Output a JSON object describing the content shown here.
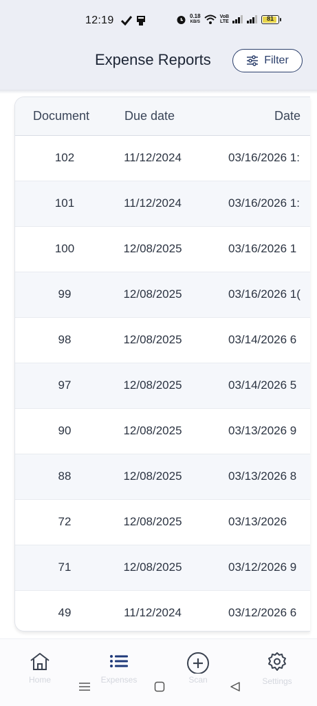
{
  "status_bar": {
    "time": "12:19",
    "speed_value": "0.18",
    "speed_unit": "KB/S",
    "volte_top": "VoB",
    "volte_bottom": "LTE",
    "battery": "81"
  },
  "header": {
    "title": "Expense Reports",
    "filter_label": "Filter"
  },
  "table": {
    "columns": [
      "Document",
      "Due date",
      "Date"
    ],
    "rows": [
      {
        "document": "102",
        "due_date": "11/12/2024",
        "date": "03/16/2026 1:"
      },
      {
        "document": "101",
        "due_date": "11/12/2024",
        "date": "03/16/2026 1:"
      },
      {
        "document": "100",
        "due_date": "12/08/2025",
        "date": "03/16/2026 1"
      },
      {
        "document": "99",
        "due_date": "12/08/2025",
        "date": "03/16/2026 1("
      },
      {
        "document": "98",
        "due_date": "12/08/2025",
        "date": "03/14/2026 6"
      },
      {
        "document": "97",
        "due_date": "12/08/2025",
        "date": "03/14/2026 5"
      },
      {
        "document": "90",
        "due_date": "12/08/2025",
        "date": "03/13/2026 9"
      },
      {
        "document": "88",
        "due_date": "12/08/2025",
        "date": "03/13/2026 8"
      },
      {
        "document": "72",
        "due_date": "12/08/2025",
        "date": "03/13/2026 "
      },
      {
        "document": "71",
        "due_date": "12/08/2025",
        "date": "03/12/2026 9"
      },
      {
        "document": "49",
        "due_date": "11/12/2024",
        "date": "03/12/2026 6"
      }
    ]
  },
  "bottom_nav": {
    "items": [
      {
        "label": "Home",
        "icon": "home-icon"
      },
      {
        "label": "Expenses",
        "icon": "list-icon"
      },
      {
        "label": "Scan",
        "icon": "plus-circle-icon"
      },
      {
        "label": "Settings",
        "icon": "gear-icon"
      }
    ]
  },
  "colors": {
    "header_bg": "#eceef5",
    "accent": "#2b3f6b",
    "row_alt": "#f5f7fb",
    "nav_active": "#1f3a7a",
    "nav_inactive": "#3a4250"
  }
}
